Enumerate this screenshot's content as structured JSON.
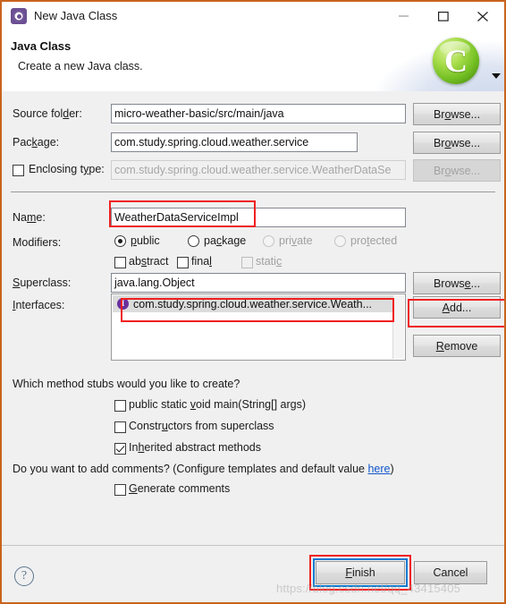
{
  "window": {
    "title": "New Java Class",
    "icon": "java-class-icon",
    "controls": {
      "minimize": "minimize-icon",
      "maximize": "maximize-icon",
      "close": "close-icon"
    }
  },
  "header": {
    "title": "Java Class",
    "description": "Create a new Java class.",
    "logo": "eclipse-c-logo"
  },
  "form": {
    "source_folder": {
      "label": "Source folder:",
      "value": "micro-weather-basic/src/main/java",
      "browse": "Browse..."
    },
    "package": {
      "label": "Package:",
      "value": "com.study.spring.cloud.weather.service",
      "browse": "Browse..."
    },
    "enclosing_type": {
      "label": "Enclosing type:",
      "value": "com.study.spring.cloud.weather.service.WeatherDataSe",
      "browse": "Browse...",
      "checked": false,
      "enabled": false
    },
    "name": {
      "label": "Name:",
      "value": "WeatherDataServiceImpl"
    },
    "modifiers": {
      "label": "Modifiers:",
      "access": [
        {
          "label": "public",
          "selected": true,
          "enabled": true
        },
        {
          "label": "package",
          "selected": false,
          "enabled": true
        },
        {
          "label": "private",
          "selected": false,
          "enabled": false
        },
        {
          "label": "protected",
          "selected": false,
          "enabled": false
        }
      ],
      "flags": [
        {
          "label": "abstract",
          "checked": false,
          "enabled": true
        },
        {
          "label": "final",
          "checked": false,
          "enabled": true
        },
        {
          "label": "static",
          "checked": false,
          "enabled": false
        }
      ]
    },
    "superclass": {
      "label": "Superclass:",
      "value": "java.lang.Object",
      "browse": "Browse..."
    },
    "interfaces": {
      "label": "Interfaces:",
      "items": [
        {
          "text": "com.study.spring.cloud.weather.service.Weath...",
          "icon": "interface-icon"
        }
      ],
      "add": "Add...",
      "remove": "Remove"
    }
  },
  "stubs": {
    "question": "Which method stubs would you like to create?",
    "options": [
      {
        "label": "public static void main(String[] args)",
        "checked": false
      },
      {
        "label": "Constructors from superclass",
        "checked": false
      },
      {
        "label": "Inherited abstract methods",
        "checked": true
      }
    ]
  },
  "comments": {
    "question_prefix": "Do you want to add comments? (Configure templates and default value ",
    "link": "here",
    "question_suffix": ")",
    "option": {
      "label": "Generate comments",
      "checked": false
    }
  },
  "footer": {
    "help": "help-icon",
    "finish": "Finish",
    "cancel": "Cancel"
  },
  "watermark": "https://blog.csdn.net/qq_43415405",
  "colors": {
    "annotation": "#f02020",
    "focus_ring": "#0b7ad1",
    "link": "#1155cc",
    "window_border": "#c8641e",
    "interface_icon": "#6b2f9c",
    "logo_green": "#74c023"
  }
}
